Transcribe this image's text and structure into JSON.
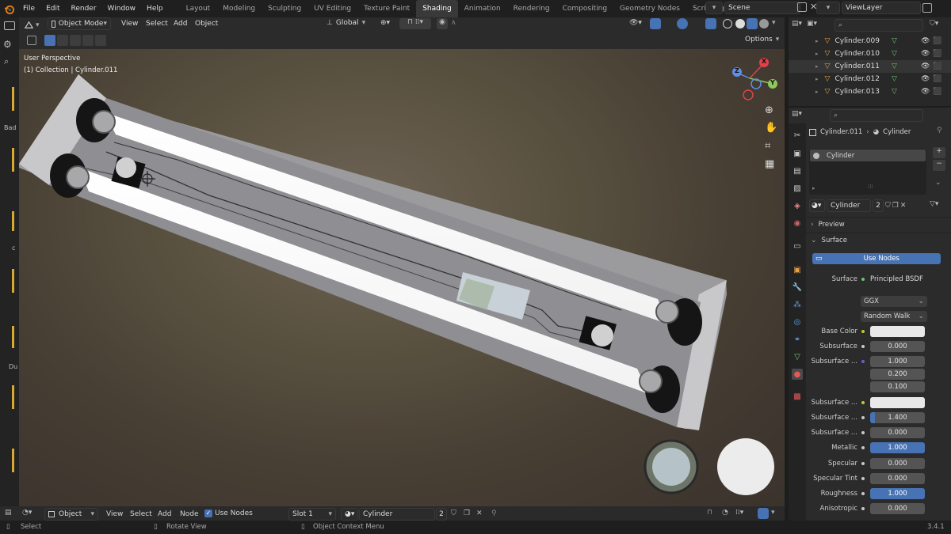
{
  "topbar": {
    "menus": [
      "File",
      "Edit",
      "Render",
      "Window",
      "Help"
    ],
    "workspaces": [
      "Layout",
      "Modeling",
      "Sculpting",
      "UV Editing",
      "Texture Paint",
      "Shading",
      "Animation",
      "Rendering",
      "Compositing",
      "Geometry Nodes",
      "Scripting"
    ],
    "active_workspace": "Shading",
    "add_tab": "+",
    "scene": "Scene",
    "view_layer": "ViewLayer"
  },
  "viewport_header": {
    "mode": "Object Mode",
    "menus": [
      "View",
      "Select",
      "Add",
      "Object"
    ],
    "transform": "Global",
    "options": "Options"
  },
  "viewport": {
    "perspective": "User Perspective",
    "collection": "(1) Collection | Cylinder.011",
    "gizmo": {
      "x": "X",
      "y": "Y",
      "z": "Z"
    }
  },
  "left_labels": {
    "bad": "Bad",
    "c": "c",
    "du": "Du"
  },
  "outliner": {
    "items": [
      {
        "name": "Cylinder.009"
      },
      {
        "name": "Cylinder.010"
      },
      {
        "name": "Cylinder.011"
      },
      {
        "name": "Cylinder.012"
      },
      {
        "name": "Cylinder.013"
      }
    ],
    "selected_index": 2
  },
  "properties": {
    "breadcrumb_object": "Cylinder.011",
    "breadcrumb_material": "Cylinder",
    "slot_name": "Cylinder",
    "material_name": "Cylinder",
    "users": "2",
    "preview_label": "Preview",
    "surface_section": "Surface",
    "use_nodes_button": "Use Nodes",
    "surface_label": "Surface",
    "surface_value": "Principled BSDF",
    "distribution": "GGX",
    "subsurface_method": "Random Walk",
    "rows": [
      {
        "label": "Base Color",
        "value": "",
        "kind": "white"
      },
      {
        "label": "Subsurface",
        "value": "0.000",
        "kind": "grey"
      },
      {
        "label": "Subsurface ...",
        "value": "1.000",
        "kind": "grey"
      },
      {
        "label": "",
        "value": "0.200",
        "kind": "grey"
      },
      {
        "label": "",
        "value": "0.100",
        "kind": "grey"
      },
      {
        "label": "Subsurface ...",
        "value": "",
        "kind": "white"
      },
      {
        "label": "Subsurface ...",
        "value": "1.400",
        "kind": "grey"
      },
      {
        "label": "Subsurface ...",
        "value": "0.000",
        "kind": "grey"
      },
      {
        "label": "Metallic",
        "value": "1.000",
        "kind": "blue"
      },
      {
        "label": "Specular",
        "value": "0.000",
        "kind": "grey"
      },
      {
        "label": "Specular Tint",
        "value": "0.000",
        "kind": "grey"
      },
      {
        "label": "Roughness",
        "value": "1.000",
        "kind": "blue"
      },
      {
        "label": "Anisotropic",
        "value": "0.000",
        "kind": "grey"
      }
    ]
  },
  "bottombar": {
    "editor_mode": "Object",
    "menus": [
      "View",
      "Select",
      "Add",
      "Node"
    ],
    "use_nodes": "Use Nodes",
    "slot": "Slot 1",
    "material": "Cylinder",
    "users": "2"
  },
  "statusbar": {
    "select": "Select",
    "rotate": "Rotate View",
    "context": "Object Context Menu",
    "version": "3.4.1"
  }
}
